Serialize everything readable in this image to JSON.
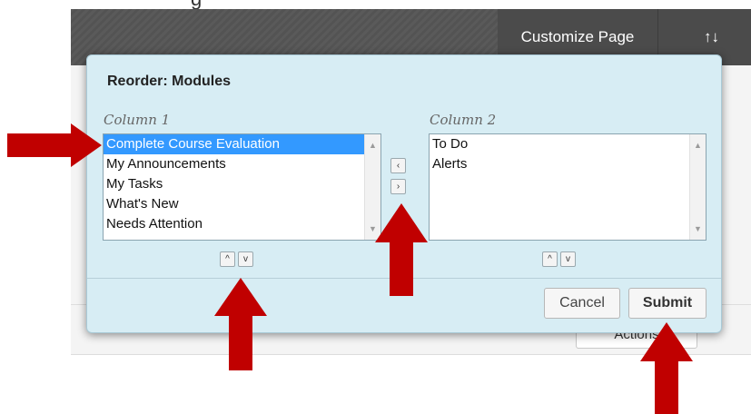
{
  "background": {
    "page_title_fragment": "g",
    "customize_page_label": "Customize Page",
    "sort_icon_label": "↑↓",
    "actions_label": "Actions"
  },
  "dialog": {
    "title": "Reorder: Modules",
    "column1": {
      "label": "Column 1",
      "items": [
        "Complete Course Evaluation",
        "My Announcements",
        "My Tasks",
        "What's New",
        "Needs Attention"
      ],
      "selected_index": 0
    },
    "column2": {
      "label": "Column 2",
      "items": [
        "To Do",
        "Alerts"
      ]
    },
    "move_left_icon": "‹",
    "move_right_icon": "›",
    "move_up_icon": "^",
    "move_down_icon": "v",
    "cancel_label": "Cancel",
    "submit_label": "Submit"
  },
  "colors": {
    "selection": "#3399ff",
    "dialog_bg": "#d7edf4",
    "annotation_arrow": "#c00000"
  }
}
